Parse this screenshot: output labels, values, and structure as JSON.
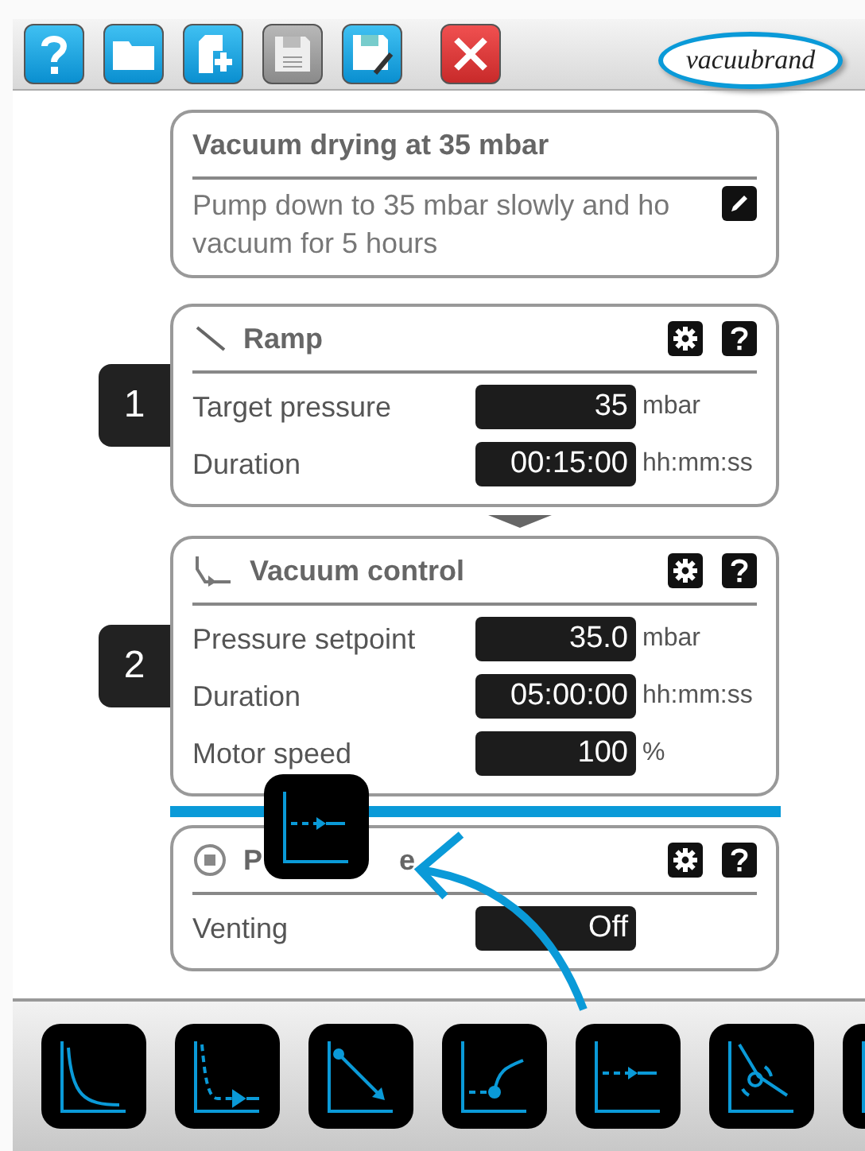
{
  "toolbar": {
    "logo": "vacuubrand"
  },
  "method": {
    "title": "Vacuum drying at 35 mbar",
    "description_lines": [
      "Pump down to 35 mbar slowly and ho",
      "vacuum for 5 hours"
    ]
  },
  "steps": [
    {
      "kind": "ramp",
      "number": "1",
      "title": "Ramp",
      "fields": [
        {
          "label": "Target pressure",
          "value": "35",
          "unit": "mbar"
        },
        {
          "label": "Duration",
          "value": "00:15:00",
          "unit": "hh:mm:ss"
        }
      ]
    },
    {
      "kind": "vacuum_control",
      "number": "2",
      "title": "Vacuum control",
      "fields": [
        {
          "label": "Pressure setpoint",
          "value": "35.0",
          "unit": "mbar"
        },
        {
          "label": "Duration",
          "value": "05:00:00",
          "unit": "hh:mm:ss"
        },
        {
          "label": "Motor speed",
          "value": "100",
          "unit": "%"
        }
      ]
    },
    {
      "kind": "end",
      "title_fragments": [
        "P",
        "e"
      ],
      "fields": [
        {
          "label": "Venting",
          "value": "Off"
        }
      ]
    }
  ]
}
